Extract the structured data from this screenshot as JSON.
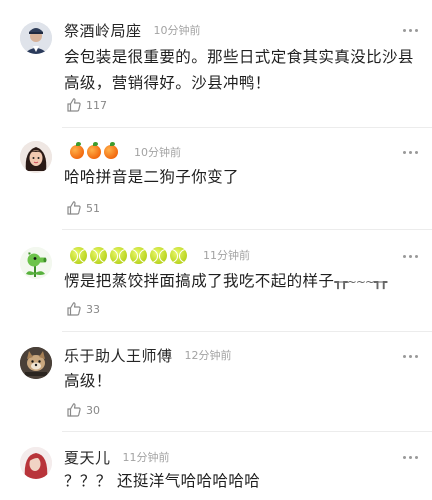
{
  "comments": [
    {
      "username": "祭酒岭局座",
      "time": "10分钟前",
      "text": "会包装是很重要的。那些日式定食其实真没比沙县高级，营销得好。沙县冲鸭！",
      "likes": "117",
      "avatar_icon": "uniformed-man-avatar",
      "badges": []
    },
    {
      "username": "",
      "time": "10分钟前",
      "text": "哈哈拼音是二狗子你变了",
      "likes": "51",
      "avatar_icon": "cartoon-girl-avatar",
      "badges": [
        "orange",
        "orange",
        "orange"
      ]
    },
    {
      "username": "",
      "time": "11分钟前",
      "text": "愣是把蒸饺拌面搞成了我吃不起的样子",
      "text_suffix": "┱┲~~~┱┲",
      "likes": "33",
      "avatar_icon": "peashooter-plant-avatar",
      "badges": [
        "tennis-ball",
        "tennis-ball",
        "tennis-ball",
        "tennis-ball",
        "tennis-ball",
        "tennis-ball"
      ]
    },
    {
      "username": "乐于助人王师傅",
      "time": "12分钟前",
      "text": "高级！",
      "likes": "30",
      "avatar_icon": "dog-photo-avatar",
      "badges": []
    },
    {
      "username": "夏天儿",
      "time": "11分钟前",
      "text": "？？？ 还挺洋气哈哈哈哈哈",
      "likes": "",
      "avatar_icon": "red-haired-woman-avatar",
      "badges": []
    }
  ],
  "colors": {
    "text": "#1f1f1f",
    "meta": "#a3a3a3",
    "like": "#888888"
  }
}
